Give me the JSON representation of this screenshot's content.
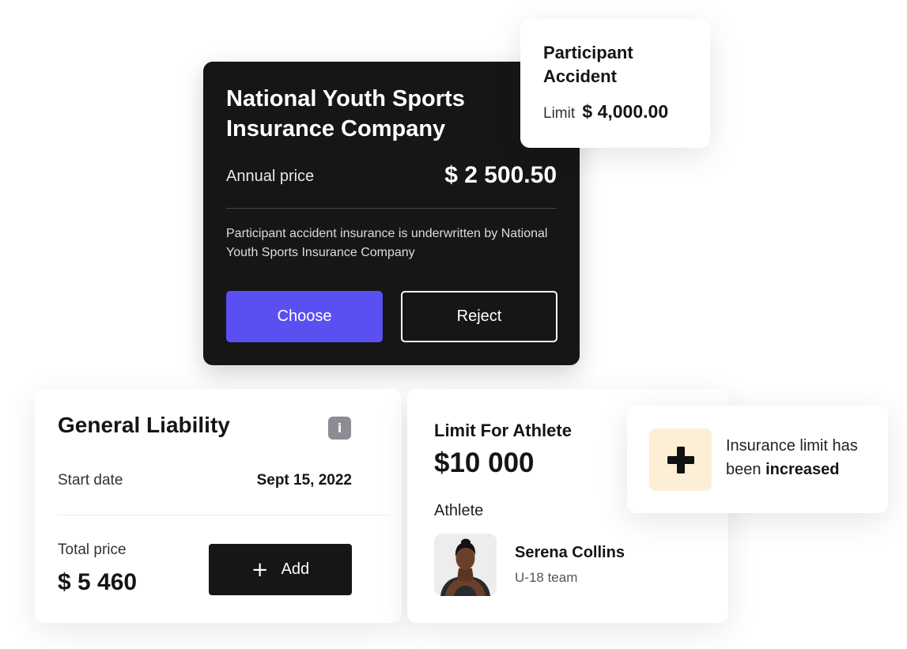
{
  "insurance_offer": {
    "company": "National Youth Sports Insurance Company",
    "annual_price_label": "Annual price",
    "annual_price": "$ 2 500.50",
    "note": "Participant accident insurance is underwritten by National Youth Sports  Insurance Company",
    "choose_label": "Choose",
    "reject_label": "Reject",
    "accent_color": "#5a4ff0"
  },
  "participant_accident": {
    "title": "Participant Accident",
    "limit_label": "Limit",
    "limit_value": "$ 4,000.00"
  },
  "general_liability": {
    "title": "General Liability",
    "info_icon": "info-icon",
    "start_date_label": "Start date",
    "start_date": "Sept 15, 2022",
    "total_price_label": "Total price",
    "total_price": "$ 5 460",
    "add_label": "Add"
  },
  "athlete_limit": {
    "title": "Limit For Athlete",
    "value": "$10 000",
    "section_label": "Athlete",
    "athlete_name": "Serena Collins",
    "athlete_team": "U-18 team"
  },
  "notification": {
    "icon": "plus-icon",
    "text_prefix": "Insurance limit has been ",
    "text_emphasis": "increased",
    "icon_bg": "#fcefd6"
  }
}
